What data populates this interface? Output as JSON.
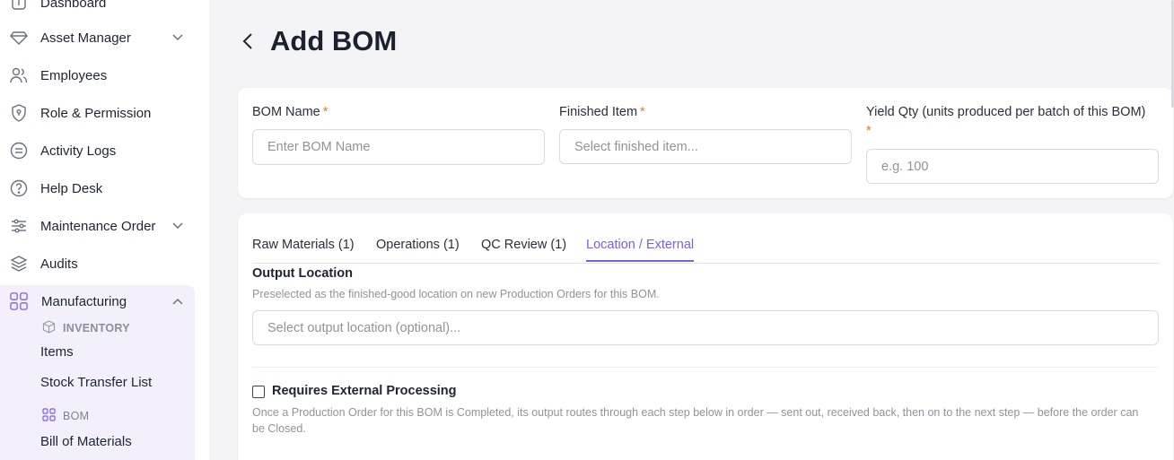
{
  "sidebar": {
    "items": [
      {
        "label": "Dashboard",
        "icon": "dashboard-icon"
      },
      {
        "label": "Asset Manager",
        "icon": "diamond-icon",
        "has_chevron": true
      },
      {
        "label": "Employees",
        "icon": "users-icon"
      },
      {
        "label": "Role & Permission",
        "icon": "shield-icon"
      },
      {
        "label": "Activity Logs",
        "icon": "list-icon"
      },
      {
        "label": "Help Desk",
        "icon": "help-circle-icon"
      },
      {
        "label": "Maintenance Order",
        "icon": "sliders-icon",
        "has_chevron": true
      },
      {
        "label": "Audits",
        "icon": "layers-icon"
      },
      {
        "label": "Manufacturing",
        "icon": "modules-icon",
        "expanded": true
      }
    ],
    "manufacturing": {
      "inventory_header": "INVENTORY",
      "inventory_items": [
        "Items",
        "Stock Transfer List"
      ],
      "bom_header": "BOM",
      "bom_items": [
        "Bill of Materials"
      ]
    }
  },
  "header": {
    "title": "Add BOM"
  },
  "form": {
    "bom_name": {
      "label": "BOM Name",
      "required": "*",
      "placeholder": "Enter BOM Name",
      "value": ""
    },
    "finished_item": {
      "label": "Finished Item",
      "required": "*",
      "placeholder": "Select finished item...",
      "value": ""
    },
    "yield_qty": {
      "label": "Yield Qty (units produced per batch of this BOM)",
      "required": "*",
      "placeholder": "e.g. 100",
      "value": ""
    }
  },
  "tabs": [
    {
      "label": "Raw Materials (1)",
      "active": false
    },
    {
      "label": "Operations (1)",
      "active": false
    },
    {
      "label": "QC Review (1)",
      "active": false
    },
    {
      "label": "Location / External",
      "active": true
    }
  ],
  "location": {
    "title": "Output Location",
    "help": "Preselected as the finished-good location on new Production Orders for this BOM.",
    "placeholder": "Select output location (optional)..."
  },
  "external": {
    "label": "Requires External Processing",
    "checked": false,
    "help": "Once a Production Order for this BOM is Completed, its output routes through each step below in order — sent out, received back, then on to the next step — before the order can be Closed."
  },
  "colors": {
    "accent": "#7a5fe0",
    "required": "#ea7b1f",
    "sidebar_active_bg": "#f3f0fc"
  }
}
